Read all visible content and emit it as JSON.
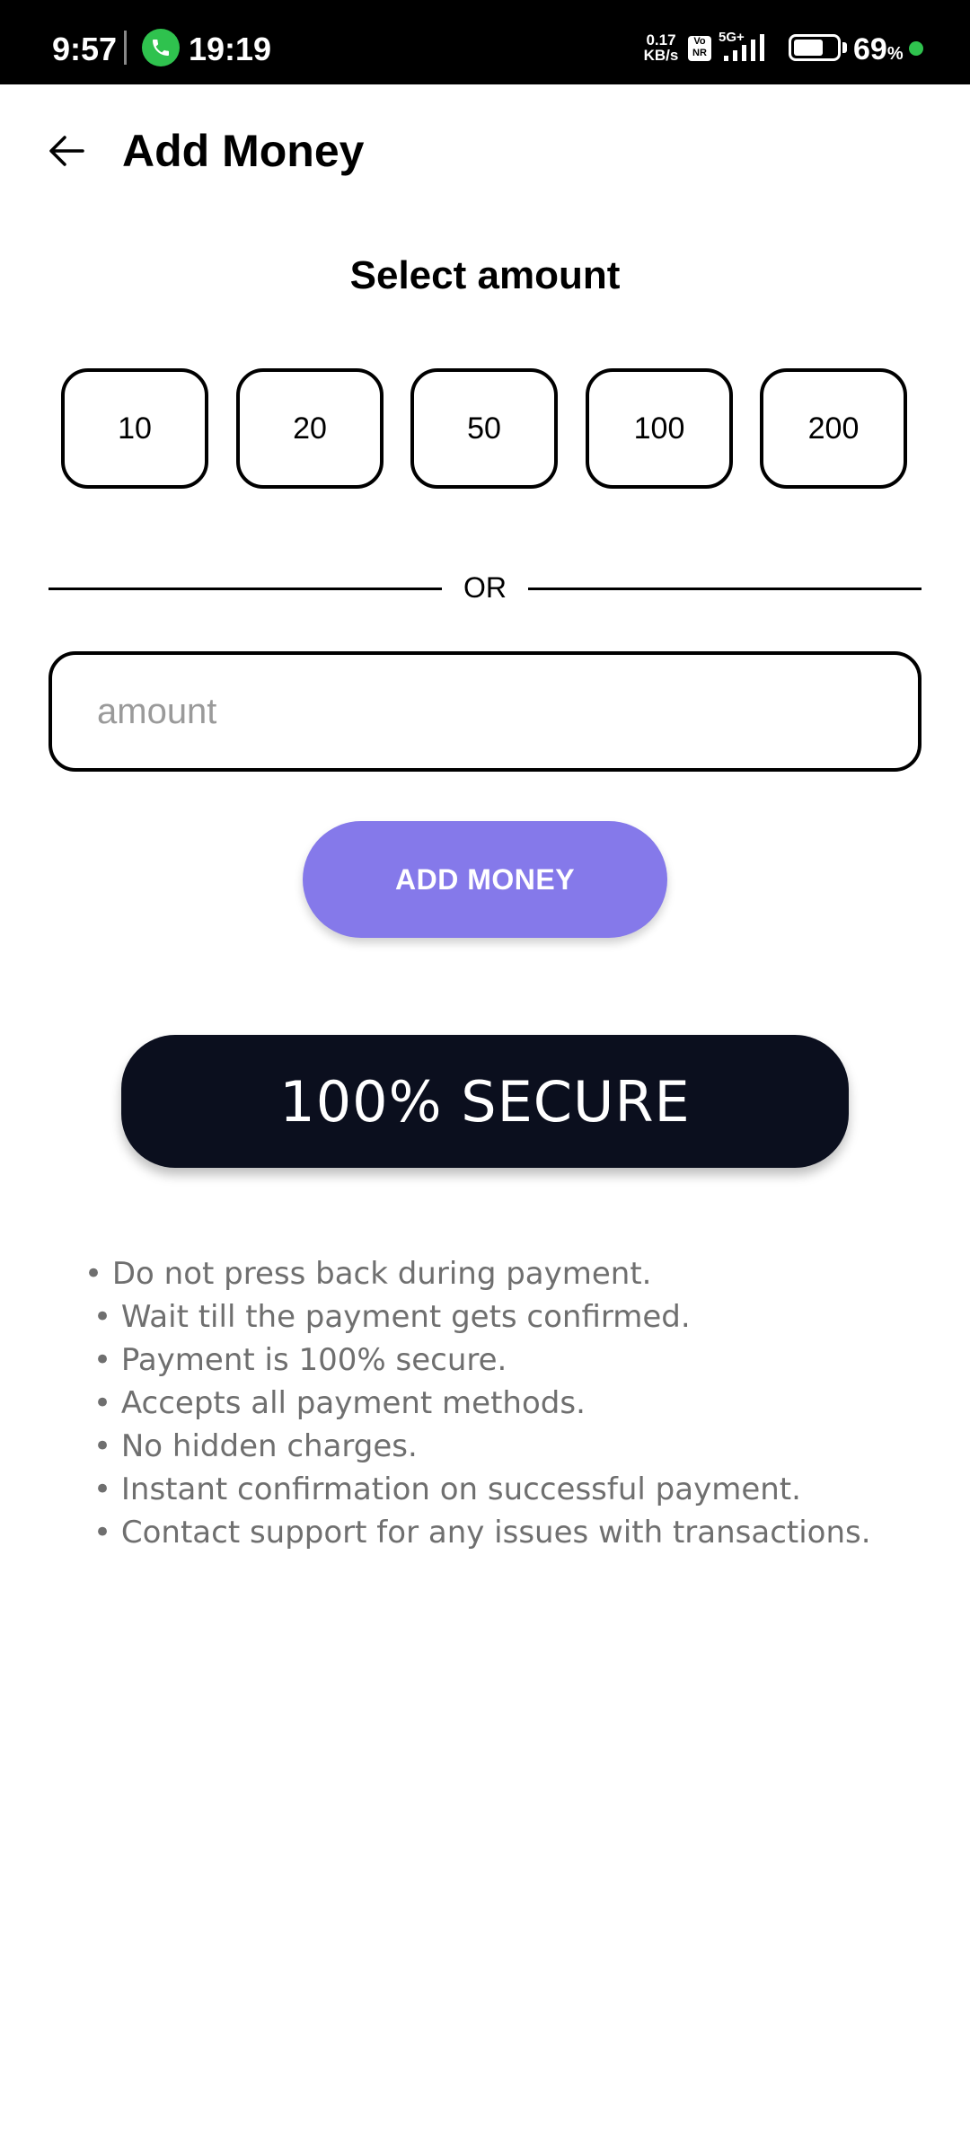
{
  "status_bar": {
    "time": "9:57",
    "call_time": "19:19",
    "net_speed_value": "0.17",
    "net_speed_unit": "KB/s",
    "volte": "Vo NR",
    "network": "5G+",
    "battery_percent": 69,
    "battery_label": "69",
    "battery_unit": "%"
  },
  "header": {
    "title": "Add Money",
    "back_icon": "arrow-left-icon"
  },
  "select": {
    "title": "Select amount",
    "amounts": [
      "10",
      "20",
      "50",
      "100",
      "200"
    ]
  },
  "divider": {
    "label": "OR"
  },
  "amount_input": {
    "value": "",
    "placeholder": "amount"
  },
  "add_button": {
    "label": "ADD MONEY"
  },
  "secure": {
    "label": "100% SECURE"
  },
  "info": [
    "• Do not press back during payment.",
    "• Wait till the payment gets confirmed.",
    "• Payment is 100% secure.",
    "• Accepts all payment methods.",
    "• No hidden charges.",
    "• Instant confirmation on successful payment.",
    "• Contact support for any issues with transactions."
  ],
  "colors": {
    "accent": "#8579ea",
    "secure_bg": "#0b0f1e",
    "call_green": "#2fc24e",
    "info_text": "#6f6f6f"
  }
}
